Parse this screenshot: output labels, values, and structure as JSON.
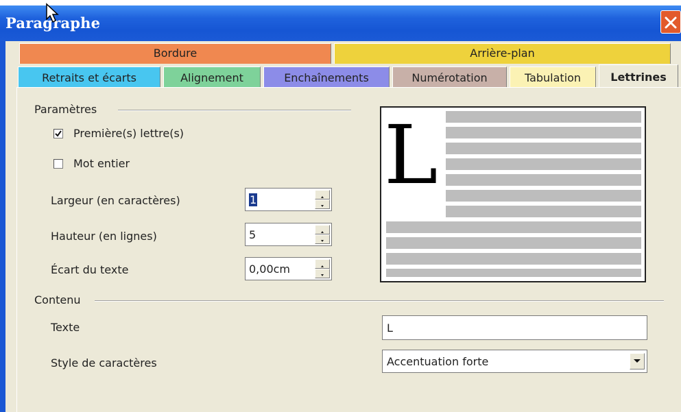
{
  "window": {
    "title": "Paragraphe"
  },
  "tabs_row1": [
    {
      "label": "Bordure",
      "color": "#f08850"
    },
    {
      "label": "Arrière-plan",
      "color": "#eed23c"
    }
  ],
  "tabs_row2": [
    {
      "label": "Retraits et écarts",
      "color": "#48c6f0"
    },
    {
      "label": "Alignement",
      "color": "#7ed29a"
    },
    {
      "label": "Enchaînements",
      "color": "#8c8ce8"
    },
    {
      "label": "Numérotation",
      "color": "#c8b0a8"
    },
    {
      "label": "Tabulation",
      "color": "#fbf2b4"
    },
    {
      "label": "Lettrines",
      "color": "#ece9d8",
      "active": true
    }
  ],
  "parametres": {
    "heading": "Paramètres",
    "premiere_lettre": {
      "label": "Première(s) lettre(s)",
      "checked": true
    },
    "mot_entier": {
      "label": "Mot entier",
      "checked": false
    },
    "largeur": {
      "label": "Largeur (en caractères)",
      "value": "1"
    },
    "hauteur": {
      "label": "Hauteur (en lignes)",
      "value": "5"
    },
    "ecart": {
      "label": "Écart du texte",
      "value": "0,00cm"
    }
  },
  "preview": {
    "letter": "L",
    "line_color": "#bdbdbd"
  },
  "contenu": {
    "heading": "Contenu",
    "texte": {
      "label": "Texte",
      "value": "L"
    },
    "style": {
      "label": "Style de caractères",
      "value": "Accentuation forte"
    }
  }
}
